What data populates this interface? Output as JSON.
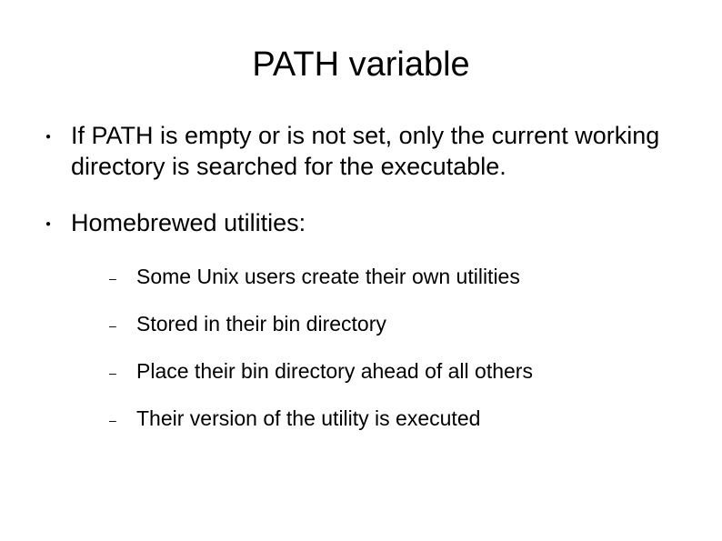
{
  "slide": {
    "title": "PATH variable",
    "bullets": [
      {
        "text": "If PATH is empty or is not set, only the current working directory is searched for the executable."
      },
      {
        "text": "Homebrewed utilities:",
        "subitems": [
          "Some Unix users create their own utilities",
          "Stored in their bin directory",
          "Place their bin directory ahead of all others",
          "Their version of the utility is executed"
        ]
      }
    ]
  }
}
